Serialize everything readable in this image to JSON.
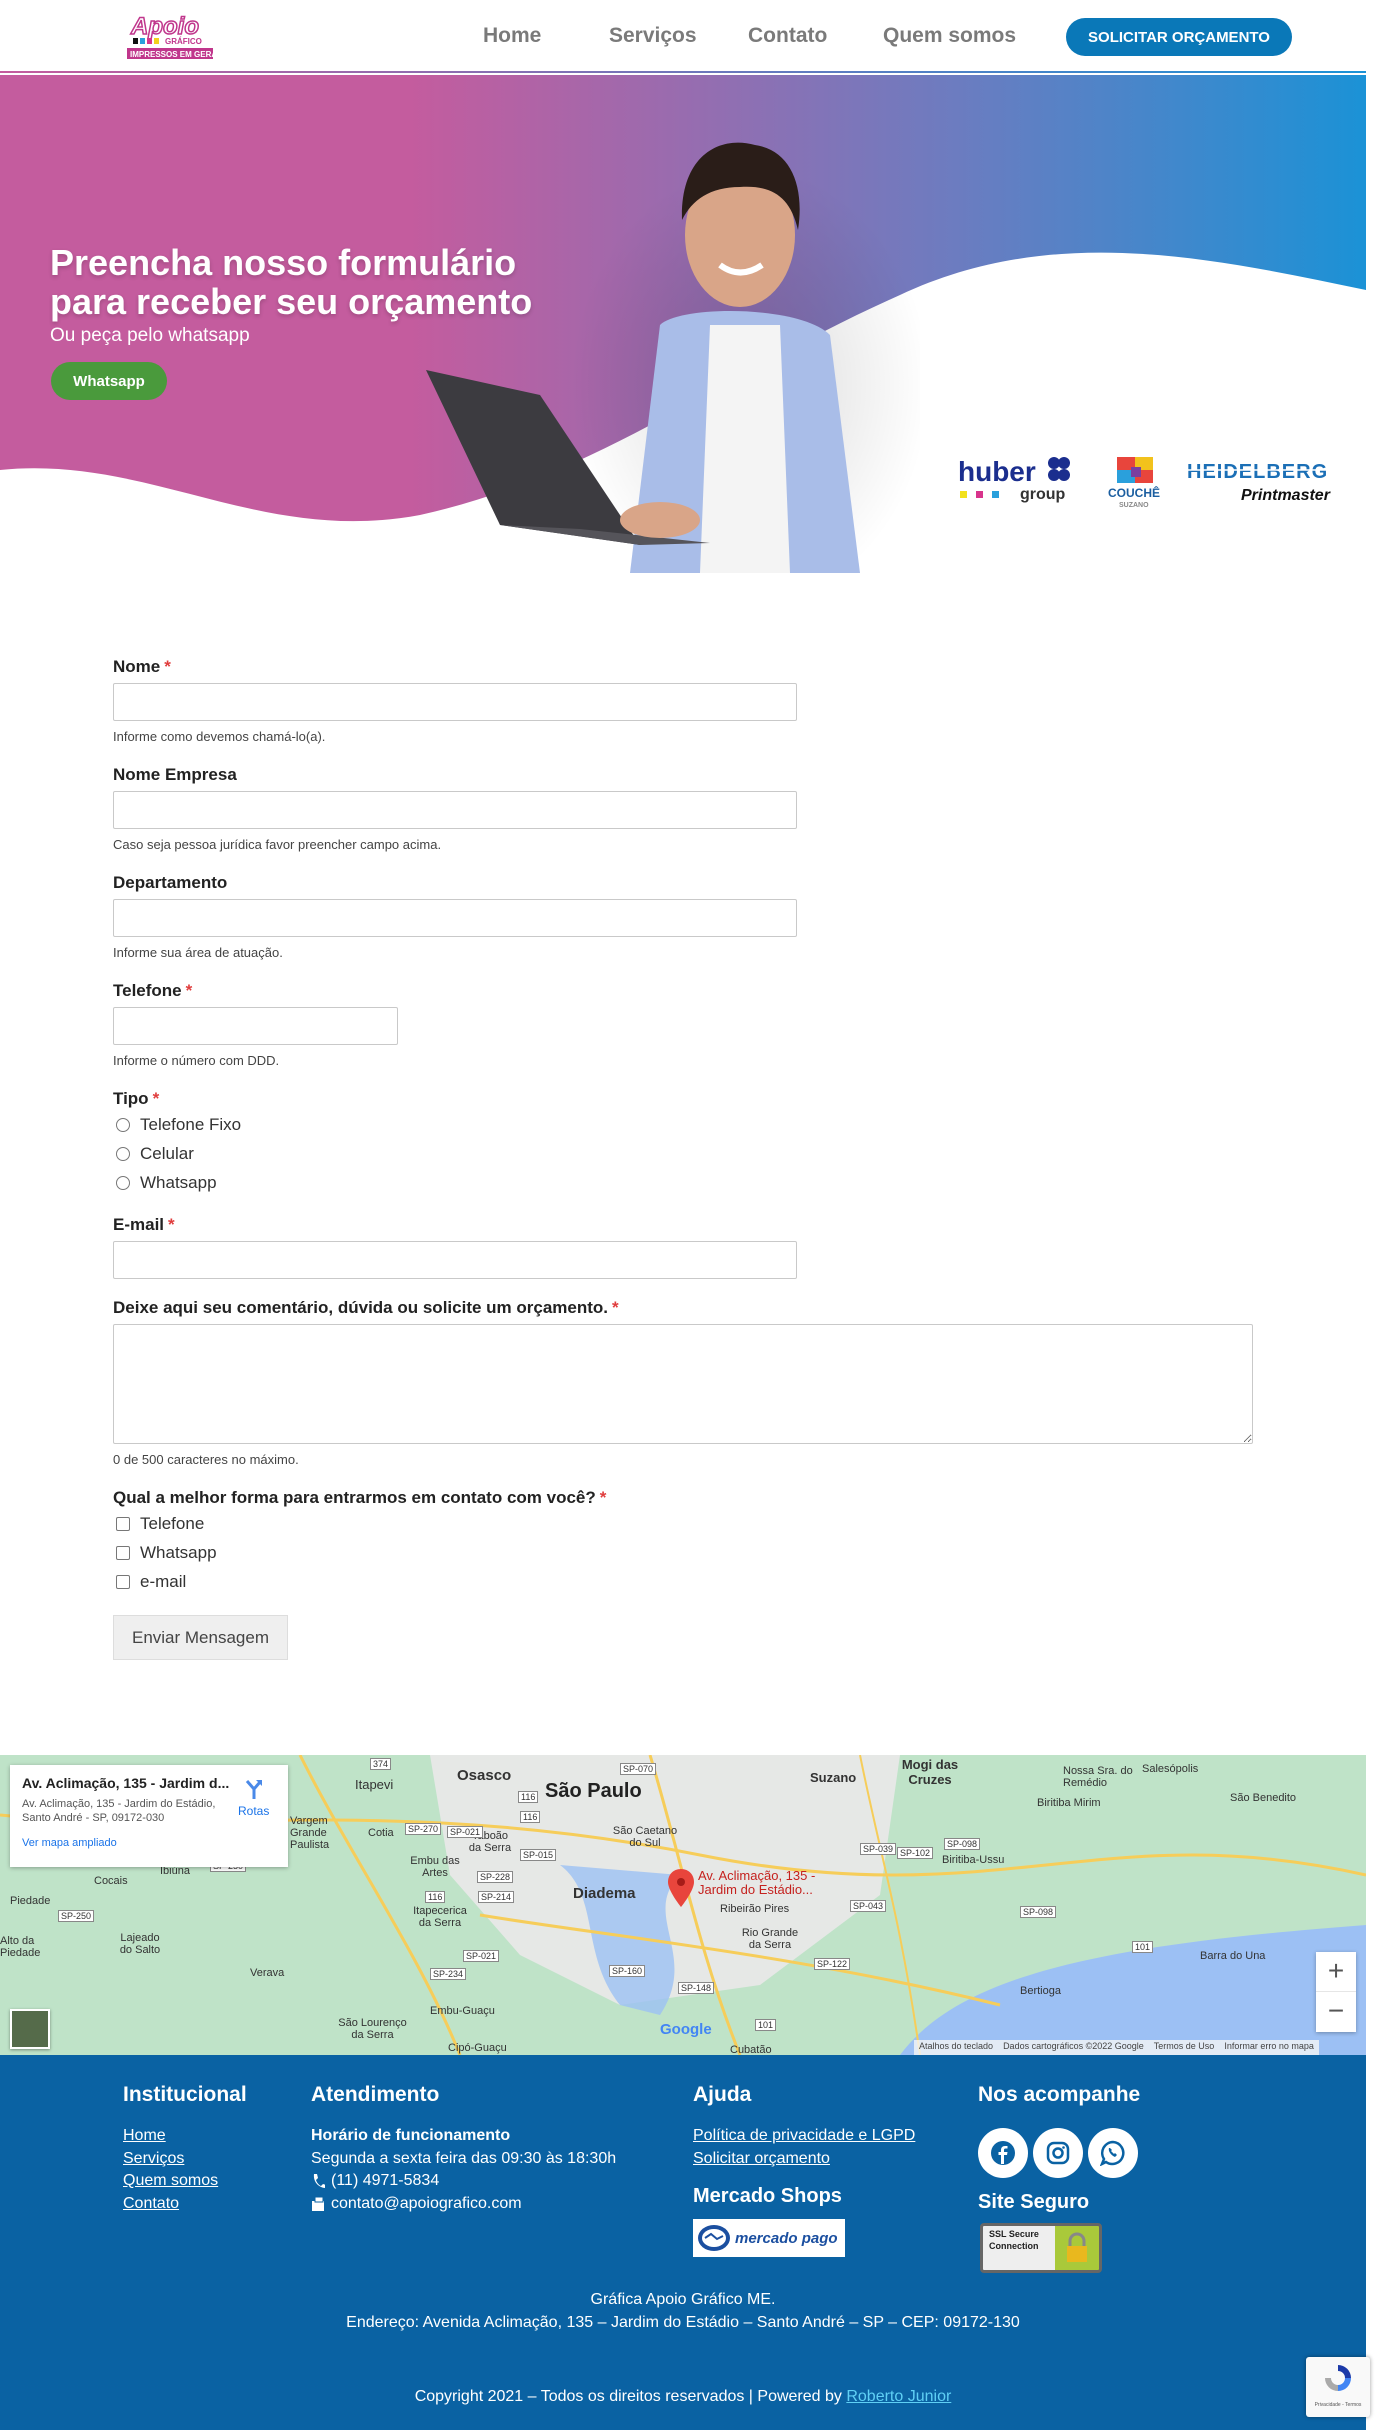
{
  "header": {
    "logo_text": "Apoio Gráfico - Impressos em Geral",
    "nav": [
      {
        "label": "Home"
      },
      {
        "label": "Serviços"
      },
      {
        "label": "Contato"
      },
      {
        "label": "Quem somos"
      }
    ],
    "cta_label": "SOLICITAR ORÇAMENTO"
  },
  "hero": {
    "title_line1": "Preencha nosso formulário",
    "title_line2": "para receber seu orçamento",
    "subtitle": "Ou peça pelo whatsapp",
    "button_label": "Whatsapp",
    "partners": [
      "huber group",
      "COUCHÊ SUZANO",
      "HEIDELBERG Printmaster"
    ]
  },
  "form": {
    "nome": {
      "label": "Nome",
      "value": "",
      "hint": "Informe como devemos chamá-lo(a)."
    },
    "empresa": {
      "label": "Nome Empresa",
      "value": "",
      "hint": "Caso seja pessoa jurídica favor preencher campo acima."
    },
    "departamento": {
      "label": "Departamento",
      "value": "",
      "hint": "Informe sua área de atuação."
    },
    "telefone": {
      "label": "Telefone",
      "value": "",
      "hint": "Informe o número com DDD."
    },
    "tipo": {
      "label": "Tipo",
      "options": [
        "Telefone Fixo",
        "Celular",
        "Whatsapp"
      ]
    },
    "email": {
      "label": "E-mail",
      "value": ""
    },
    "comentario": {
      "label": "Deixe aqui seu comentário, dúvida ou solicite um orçamento.",
      "value": "",
      "hint": "0 de 500 caracteres no máximo."
    },
    "contato": {
      "label": "Qual a melhor forma para entrarmos em contato com você?",
      "options": [
        "Telefone",
        "Whatsapp",
        "e-mail"
      ]
    },
    "required_mark": "*",
    "submit_label": "Enviar Mensagem"
  },
  "map": {
    "info_title": "Av. Aclimação, 135 - Jardim d...",
    "info_address": "Av. Aclimação, 135 - Jardim do Estádio, Santo André - SP, 09172-030",
    "directions_label": "Rotas",
    "view_larger": "Ver mapa ampliado",
    "pin_label": "Av. Aclimação, 135 - Jardim do Estádio...",
    "zoom_in": "+",
    "zoom_out": "−",
    "google": "Google",
    "attribution": [
      "Atalhos do teclado",
      "Dados cartográficos ©2022 Google",
      "Termos de Uso",
      "Informar erro no mapa"
    ],
    "places": [
      "Itapevi",
      "Osasco",
      "São Paulo",
      "Suzano",
      "Mogi das Cruzes",
      "Nossa Sra. do Remédio",
      "Salesópolis",
      "São Benedito",
      "Biritiba Mirim",
      "Vargem Grande Paulista",
      "Cotia",
      "Taboão da Serra",
      "São Caetano do Sul",
      "Embu das Artes",
      "Diadema",
      "Biritiba-Ussu",
      "Cocais",
      "Ibiúna",
      "Piedade",
      "Itapecerica da Serra",
      "Ribeirão Pires",
      "Rio Grande da Serra",
      "Lajeado do Salto",
      "Verava",
      "Embu-Guaçu",
      "Bertioga",
      "Barra do Una",
      "São Lourenço da Serra",
      "Alto da Piedade",
      "Cipó-Guaçu",
      "Cubatão"
    ],
    "roads": [
      "374",
      "SP-070",
      "116",
      "SP-270",
      "SP-021",
      "116",
      "SP-015",
      "SP-228",
      "SP-214",
      "116",
      "SP-250",
      "SP-250",
      "SP-234",
      "SP-021",
      "SP-160",
      "SP-148",
      "SP-039",
      "SP-102",
      "SP-098",
      "SP-043",
      "SP-098",
      "SP-122",
      "101",
      "101"
    ]
  },
  "footer": {
    "institucional": {
      "title": "Institucional",
      "links": [
        "Home",
        "Serviços",
        "Quem somos",
        "Contato"
      ]
    },
    "atendimento": {
      "title": "Atendimento",
      "hours_title": "Horário de funcionamento",
      "hours": "Segunda a sexta feira das 09:30 às 18:30h",
      "phone": "(11) 4971-5834",
      "email": "contato@apoiografico.com"
    },
    "ajuda": {
      "title": "Ajuda",
      "links": [
        "Política de privacidade e LGPD",
        "Solicitar orçamento"
      ],
      "shops_title": "Mercado Shops",
      "shops_badge": "mercado pago"
    },
    "social": {
      "title": "Nos acompanhe",
      "icons": [
        "facebook-icon",
        "instagram-icon",
        "whatsapp-icon"
      ],
      "secure_title": "Site Seguro",
      "ssl_badge": "SSL Secure Connection"
    },
    "company": "Gráfica Apoio Gráfico ME.",
    "address": "Endereço: Avenida Aclimação, 135 – Jardim do Estádio – Santo André – SP – CEP: 09172-130",
    "copyright": "Copyright 2021 – Todos os direitos reservados | Powered by ",
    "author": "Roberto Junior",
    "recaptcha": "Privacidade - Termos"
  },
  "colors": {
    "brand_blue": "#0a78b8",
    "footer_blue": "#0a62a3",
    "whatsapp_green": "#4a9a3c",
    "hero_pink": "#c45c9e",
    "hero_blue": "#1b92d6",
    "required_red": "#e03c3c"
  }
}
